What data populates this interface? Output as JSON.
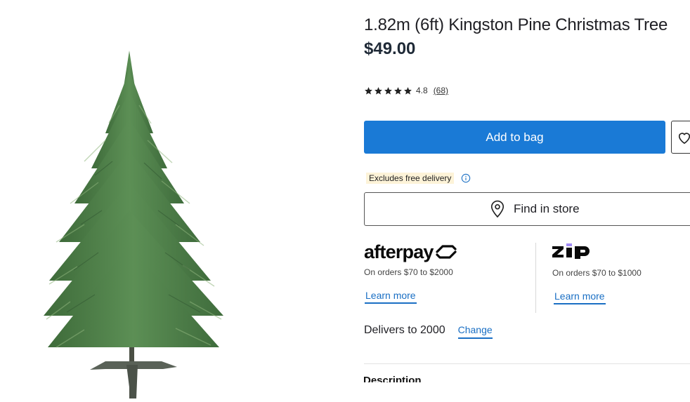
{
  "product": {
    "title": "1.82m (6ft) Kingston Pine Christmas Tree",
    "price": "$49.00",
    "image_alt": "Christmas tree"
  },
  "rating": {
    "stars": 5,
    "score": "4.8",
    "count": "(68)"
  },
  "actions": {
    "add_to_bag": "Add to bag",
    "wishlist_icon": "heart-icon"
  },
  "delivery_note": {
    "badge": "Excludes free delivery",
    "icon": "info-icon"
  },
  "find_in_store": {
    "label": "Find in store",
    "icon": "map-pin-icon"
  },
  "afterpay": {
    "logo_text": "afterpay",
    "subtitle": "On orders $70 to $2000",
    "learn_more": "Learn more"
  },
  "zip": {
    "logo_text": "zip",
    "subtitle": "On orders $70 to $1000",
    "learn_more": "Learn more"
  },
  "delivery": {
    "label": "Delivers to 2000",
    "change": "Change"
  },
  "description": {
    "heading": "Description"
  },
  "colors": {
    "primary_button": "#1a7ad6",
    "link": "#1a6fc4",
    "badge_bg": "#fdf3d8",
    "tree_green": "#4f7f4a",
    "zip_purple": "#a28bf5"
  }
}
